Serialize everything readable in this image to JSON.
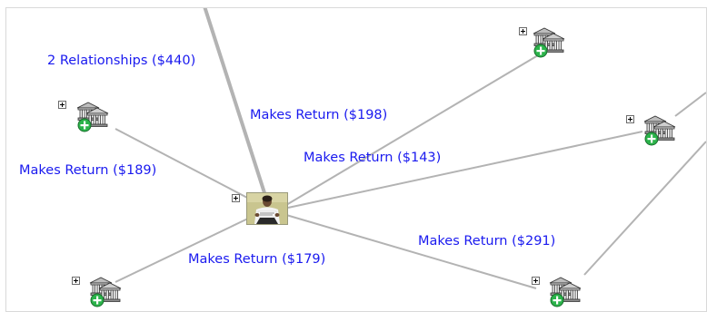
{
  "diagram": {
    "edge_labels": {
      "relationships_440": "2 Relationships ($440)",
      "return_198": "Makes Return ($198)",
      "return_189": "Makes Return ($189)",
      "return_143": "Makes Return ($143)",
      "return_291": "Makes Return ($291)",
      "return_179": "Makes Return ($179)"
    },
    "nodes": {
      "center": {
        "type": "person",
        "icon": "person-photo-icon"
      },
      "banks": [
        {
          "id": "bank-top-right",
          "icon": "bank-add-icon"
        },
        {
          "id": "bank-left-upper",
          "icon": "bank-add-icon"
        },
        {
          "id": "bank-right-middle",
          "icon": "bank-add-icon"
        },
        {
          "id": "bank-left-lower",
          "icon": "bank-add-icon"
        },
        {
          "id": "bank-bottom-right",
          "icon": "bank-add-icon"
        }
      ]
    },
    "colors": {
      "edge": "#b3b3b3",
      "label": "#1a1aef",
      "badge": "#2bb34a"
    }
  }
}
